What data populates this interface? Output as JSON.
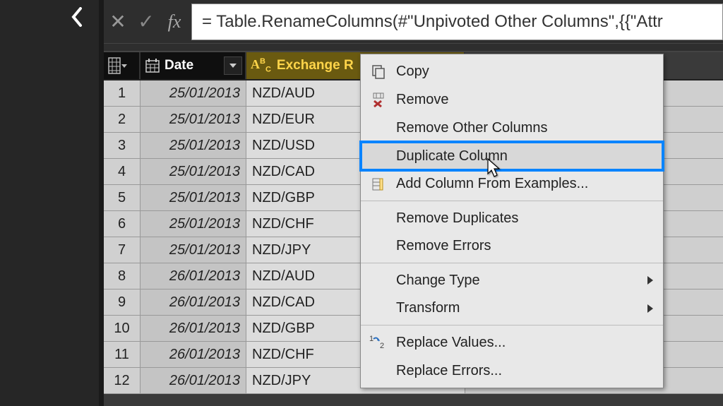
{
  "formula_bar": {
    "cancel_glyph": "✕",
    "confirm_glyph": "✓",
    "fx_label": "fx",
    "formula": "= Table.RenameColumns(#\"Unpivoted Other Columns\",{{\"Attr"
  },
  "columns": {
    "date_label": "Date",
    "exchange_label": "Exchange R",
    "abc_label": "A B C"
  },
  "rows": [
    {
      "n": "1",
      "date": "25/01/2013",
      "exch": "NZD/AUD"
    },
    {
      "n": "2",
      "date": "25/01/2013",
      "exch": "NZD/EUR"
    },
    {
      "n": "3",
      "date": "25/01/2013",
      "exch": "NZD/USD"
    },
    {
      "n": "4",
      "date": "25/01/2013",
      "exch": "NZD/CAD"
    },
    {
      "n": "5",
      "date": "25/01/2013",
      "exch": "NZD/GBP"
    },
    {
      "n": "6",
      "date": "25/01/2013",
      "exch": "NZD/CHF"
    },
    {
      "n": "7",
      "date": "25/01/2013",
      "exch": "NZD/JPY"
    },
    {
      "n": "8",
      "date": "26/01/2013",
      "exch": "NZD/AUD"
    },
    {
      "n": "9",
      "date": "26/01/2013",
      "exch": "NZD/CAD"
    },
    {
      "n": "10",
      "date": "26/01/2013",
      "exch": "NZD/GBP"
    },
    {
      "n": "11",
      "date": "26/01/2013",
      "exch": "NZD/CHF"
    },
    {
      "n": "12",
      "date": "26/01/2013",
      "exch": "NZD/JPY"
    }
  ],
  "menu": {
    "copy": "Copy",
    "remove": "Remove",
    "remove_other": "Remove Other Columns",
    "duplicate": "Duplicate Column",
    "add_from_examples": "Add Column From Examples...",
    "remove_dupes": "Remove Duplicates",
    "remove_errors": "Remove Errors",
    "change_type": "Change Type",
    "transform": "Transform",
    "replace_values": "Replace Values...",
    "replace_errors": "Replace Errors..."
  }
}
